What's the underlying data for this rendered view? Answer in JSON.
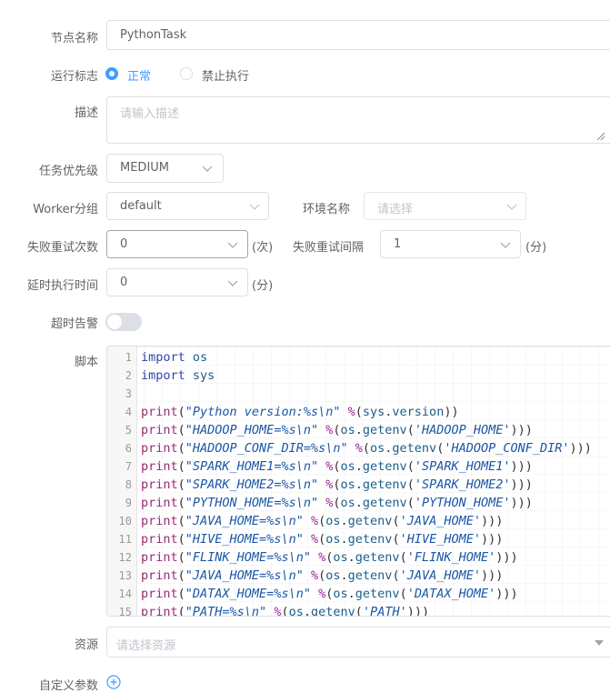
{
  "node_name": {
    "label": "节点名称",
    "value": "PythonTask"
  },
  "run_flag": {
    "label": "运行标志",
    "options": [
      "正常",
      "禁止执行"
    ],
    "selected": "正常"
  },
  "description": {
    "label": "描述",
    "placeholder": "请输入描述"
  },
  "priority": {
    "label": "任务优先级",
    "value": "MEDIUM"
  },
  "worker_group": {
    "label": "Worker分组",
    "value": "default"
  },
  "environment": {
    "label": "环境名称",
    "placeholder": "请选择"
  },
  "retry_times": {
    "label": "失败重试次数",
    "value": "0",
    "unit": "(次)"
  },
  "retry_interval": {
    "label": "失败重试间隔",
    "value": "1",
    "unit": "(分)"
  },
  "delay_time": {
    "label": "延时执行时间",
    "value": "0",
    "unit": "(分)"
  },
  "timeout_alarm": {
    "label": "超时告警",
    "enabled": false
  },
  "script": {
    "label": "脚本",
    "lines": [
      "import os",
      "import sys",
      "",
      "print(\"Python version:%s\\n\" %(sys.version))",
      "print(\"HADOOP_HOME=%s\\n\" %(os.getenv('HADOOP_HOME')))",
      "print(\"HADOOP_CONF_DIR=%s\\n\" %(os.getenv('HADOOP_CONF_DIR')))",
      "print(\"SPARK_HOME1=%s\\n\" %(os.getenv('SPARK_HOME1')))",
      "print(\"SPARK_HOME2=%s\\n\" %(os.getenv('SPARK_HOME2')))",
      "print(\"PYTHON_HOME=%s\\n\" %(os.getenv('PYTHON_HOME')))",
      "print(\"JAVA_HOME=%s\\n\" %(os.getenv('JAVA_HOME')))",
      "print(\"HIVE_HOME=%s\\n\" %(os.getenv('HIVE_HOME')))",
      "print(\"FLINK_HOME=%s\\n\" %(os.getenv('FLINK_HOME')))",
      "print(\"JAVA_HOME=%s\\n\" %(os.getenv('JAVA_HOME')))",
      "print(\"DATAX_HOME=%s\\n\" %(os.getenv('DATAX_HOME')))",
      "print(\"PATH=%s\\n\" %(os.getenv('PATH')))"
    ]
  },
  "resources": {
    "label": "资源",
    "placeholder": "请选择资源"
  },
  "custom_params": {
    "label": "自定义参数"
  },
  "colors": {
    "primary": "#409eff",
    "border": "#dcdfe6",
    "placeholder": "#c0c4cc",
    "text": "#606266"
  },
  "icons": [
    "chevron-down-icon",
    "caret-down-icon",
    "plus-circle-icon",
    "resize-handle-icon"
  ]
}
